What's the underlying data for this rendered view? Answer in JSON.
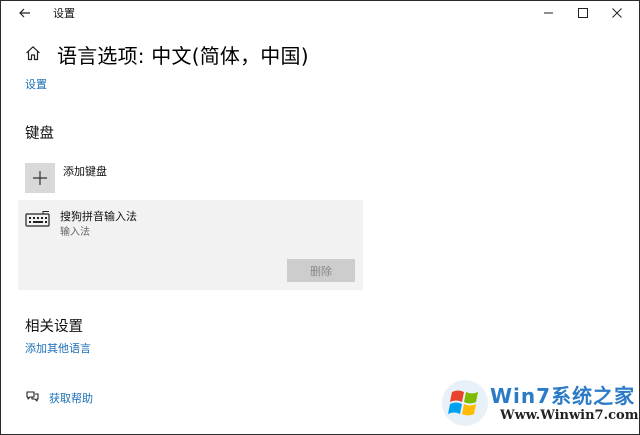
{
  "window": {
    "title": "设置",
    "back_icon": "arrow-left-icon",
    "minimize_icon": "minimize-icon",
    "maximize_icon": "maximize-icon",
    "close_icon": "close-icon"
  },
  "header": {
    "home_icon": "home-icon",
    "page_title": "语言选项: 中文(简体，中国)",
    "breadcrumb_link": "设置"
  },
  "keyboard_section": {
    "heading": "键盘",
    "add_keyboard_label": "添加键盘",
    "add_icon": "plus-icon",
    "installed": [
      {
        "icon": "keyboard-icon",
        "name": "搜狗拼音输入法",
        "type": "输入法",
        "remove_label": "删除"
      }
    ]
  },
  "related_section": {
    "heading": "相关设置",
    "link": "添加其他语言"
  },
  "help": {
    "icon": "help-chat-icon",
    "label": "获取帮助"
  },
  "watermark": {
    "brand": "Win7系统之家",
    "url": "Www.Winwin7.com"
  },
  "colors": {
    "link": "#1a6fb8",
    "card_bg": "#f2f2f2",
    "button_disabled_bg": "#cdcdcd"
  }
}
